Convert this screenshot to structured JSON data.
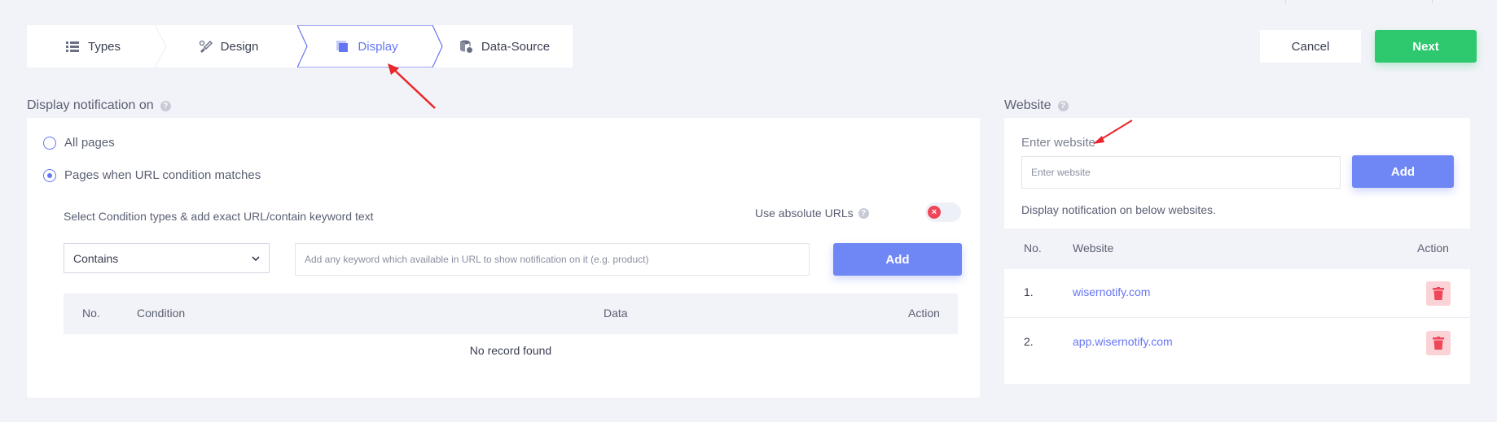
{
  "stepper": {
    "steps": [
      {
        "label": "Types",
        "icon": "list-icon"
      },
      {
        "label": "Design",
        "icon": "brush-icon"
      },
      {
        "label": "Display",
        "icon": "display-icon"
      },
      {
        "label": "Data-Source",
        "icon": "database-icon"
      }
    ],
    "active_index": 2
  },
  "actions": {
    "cancel_label": "Cancel",
    "next_label": "Next"
  },
  "display": {
    "title": "Display notification on",
    "options": [
      {
        "label": "All pages",
        "checked": false
      },
      {
        "label": "Pages when URL condition matches",
        "checked": true
      }
    ],
    "condition_label": "Select Condition types & add exact URL/contain keyword text",
    "absolute_urls_label": "Use absolute URLs",
    "absolute_urls_enabled": false,
    "condition_select_value": "Contains",
    "keyword_placeholder": "Add any keyword which available in URL to show notification on it (e.g. product)",
    "add_label": "Add",
    "table": {
      "headers": [
        "No.",
        "Condition",
        "Data",
        "Action"
      ],
      "empty_text": "No record found"
    }
  },
  "website": {
    "title": "Website",
    "enter_label": "Enter website",
    "input_placeholder": "Enter website",
    "add_label": "Add",
    "below_label": "Display notification on below websites.",
    "table": {
      "headers": [
        "No.",
        "Website",
        "Action"
      ],
      "rows": [
        {
          "no": "1.",
          "site": "wisernotify.com"
        },
        {
          "no": "2.",
          "site": "app.wisernotify.com"
        }
      ]
    }
  },
  "colors": {
    "accent": "#6576f2",
    "next": "#2ec96f",
    "danger": "#f0465a",
    "annotation_arrow": "#e8262b"
  }
}
